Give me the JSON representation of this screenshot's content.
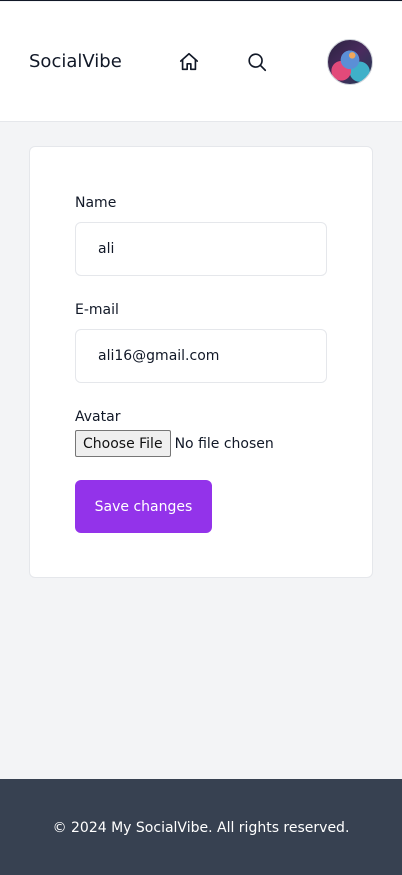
{
  "navbar": {
    "brand": "SocialVibe",
    "icons": [
      "home-icon",
      "search-icon"
    ],
    "avatar_alt": "user avatar"
  },
  "form": {
    "name_label": "Name",
    "name_value": "ali",
    "email_label": "E-mail",
    "email_value": "ali16@gmail.com",
    "avatar_label": "Avatar",
    "file_button": "Choose File",
    "file_status": "No file chosen",
    "save_label": "Save changes"
  },
  "footer": {
    "text": "© 2024 My SocialVibe. All rights reserved."
  },
  "colors": {
    "accent": "#9333ea",
    "footer_bg": "#374151",
    "page_bg": "#f3f4f6"
  }
}
